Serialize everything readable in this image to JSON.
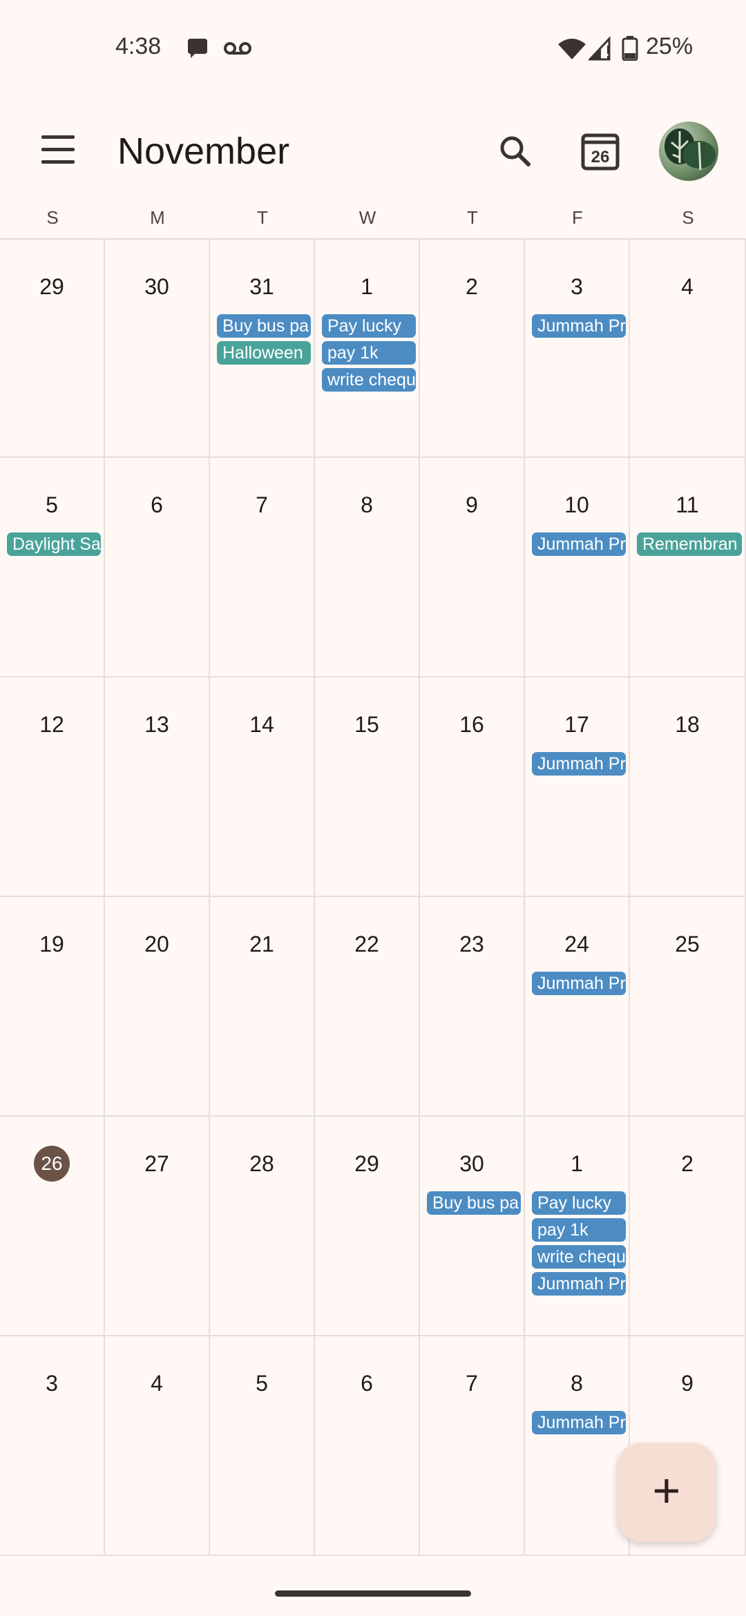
{
  "status_bar": {
    "time": "4:38",
    "icons": [
      "chat-bubble-icon",
      "voicemail-icon",
      "wifi-icon",
      "signal-icon",
      "battery-icon"
    ],
    "battery_percent": "25%"
  },
  "app_bar": {
    "month": "November",
    "today_icon_date": "26"
  },
  "weekdays": [
    "S",
    "M",
    "T",
    "W",
    "T",
    "F",
    "S"
  ],
  "weeks": [
    [
      "29",
      "30",
      "31",
      "1",
      "2",
      "3",
      "4"
    ],
    [
      "5",
      "6",
      "7",
      "8",
      "9",
      "10",
      "11"
    ],
    [
      "12",
      "13",
      "14",
      "15",
      "16",
      "17",
      "18"
    ],
    [
      "19",
      "20",
      "21",
      "22",
      "23",
      "24",
      "25"
    ],
    [
      "26",
      "27",
      "28",
      "29",
      "30",
      "1",
      "2"
    ],
    [
      "3",
      "4",
      "5",
      "6",
      "7",
      "8",
      "9"
    ]
  ],
  "today": "26",
  "events": {
    "w0_tue_1": "Buy bus pa",
    "w0_tue_2": "Halloween",
    "w0_wed_1": "Pay lucky",
    "w0_wed_2": "pay 1k",
    "w0_wed_3": "write chequ",
    "w0_fri_1": "Jummah Pr",
    "w1_sun_1": "Daylight Sa",
    "w1_fri_1": "Jummah Pr",
    "w1_sat_1": "Remembran",
    "w2_fri_1": "Jummah Pr",
    "w3_fri_1": "Jummah Pr",
    "w4_thu_1": "Buy bus pa",
    "w4_fri_1": "Pay lucky",
    "w4_fri_2": "pay 1k",
    "w4_fri_3": "write chequ",
    "w4_fri_4": "Jummah Pr",
    "w5_fri_1": "Jummah Pr"
  },
  "colors": {
    "event_blue": "#4c8cc3",
    "event_teal": "#4aa39a",
    "today_circle": "#6b5247",
    "fab": "#f6ded4",
    "background": "#fff8f5"
  },
  "fab_icon": "plus-icon"
}
